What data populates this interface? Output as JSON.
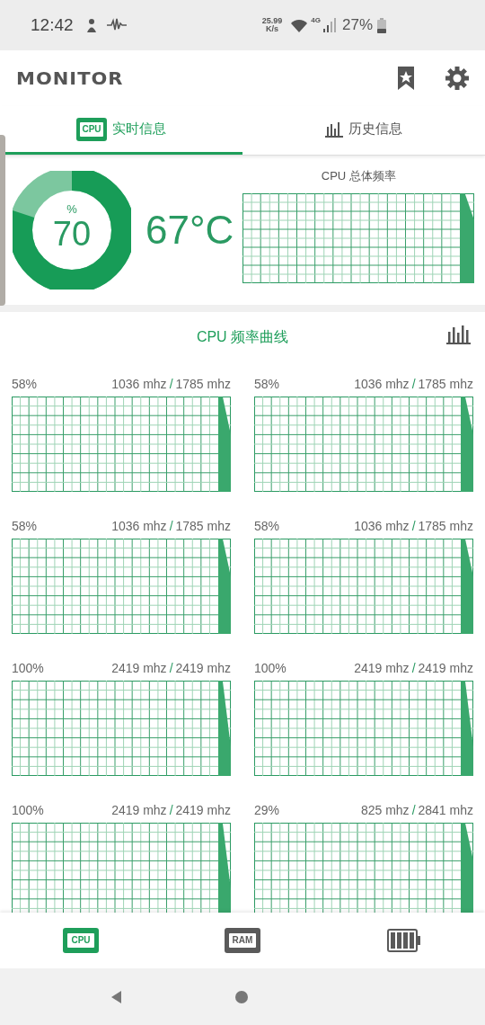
{
  "status_bar": {
    "time": "12:42",
    "net_speed": "25.99",
    "net_unit": "K/s",
    "network": "4G",
    "battery": "27%"
  },
  "app_bar": {
    "title": "MONITOR"
  },
  "tabs": [
    {
      "label": "实时信息",
      "icon_label": "CPU",
      "kind": "chip",
      "selected": true
    },
    {
      "label": "历史信息",
      "kind": "bars",
      "selected": false
    }
  ],
  "overview": {
    "load_unit": "%",
    "load": "70",
    "level": 0.8,
    "temperature": "67°C",
    "graph_title": "CPU 总体频率"
  },
  "section": {
    "title": "CPU 频率曲线"
  },
  "cores": [
    {
      "percent": "58%",
      "current": "1036 mhz",
      "separator": "/",
      "max": "1785 mhz"
    },
    {
      "percent": "58%",
      "current": "1036 mhz",
      "separator": "/",
      "max": "1785 mhz"
    },
    {
      "percent": "58%",
      "current": "1036 mhz",
      "separator": "/",
      "max": "1785 mhz"
    },
    {
      "percent": "58%",
      "current": "1036 mhz",
      "separator": "/",
      "max": "1785 mhz"
    },
    {
      "percent": "100%",
      "current": "2419 mhz",
      "separator": "/",
      "max": "2419 mhz"
    },
    {
      "percent": "100%",
      "current": "2419 mhz",
      "separator": "/",
      "max": "2419 mhz"
    },
    {
      "percent": "100%",
      "current": "2419 mhz",
      "separator": "/",
      "max": "2419 mhz"
    },
    {
      "percent": "29%",
      "current": "825 mhz",
      "separator": "/",
      "max": "2841 mhz"
    }
  ],
  "bottom_nav": [
    {
      "kind": "chip",
      "icon_label": "CPU",
      "selected": true
    },
    {
      "kind": "chip",
      "icon_label": "RAM",
      "selected": false
    },
    {
      "kind": "battery",
      "selected": false
    }
  ]
}
